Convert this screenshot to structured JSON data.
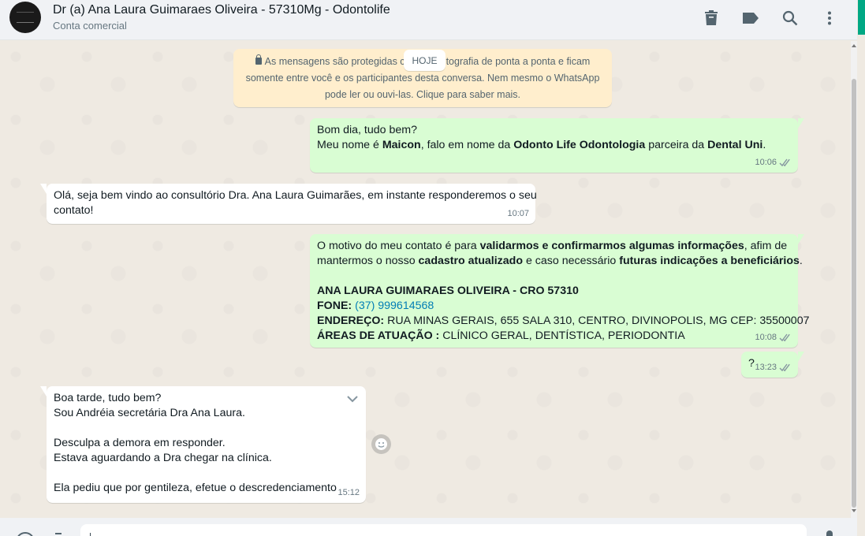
{
  "header": {
    "title": "Dr (a) Ana Laura Guimaraes Oliveira - 57310Mg - Odontolife",
    "subtitle": "Conta comercial",
    "icons": [
      "delete-icon",
      "label-icon",
      "search-icon",
      "more-vert-icon"
    ]
  },
  "chat": {
    "encryption_notice": {
      "line1_a": "As mensagens são protegidas c",
      "line1_b": "tografia de ponta a ponta e ficam",
      "line2": "somente entre você e os participantes desta conversa. Nem mesmo o WhatsApp",
      "line3": "pode ler ou ouvi-las. Clique para saber mais."
    },
    "date_label": "HOJE",
    "messages": [
      {
        "direction": "out",
        "line1": "Bom dia, tudo bem?",
        "line2_parts": [
          "Meu nome é ",
          "Maicon",
          ", falo em nome da ",
          "Odonto Life Odontologia",
          " parceira da ",
          "Dental Uni",
          "."
        ],
        "time": "10:06"
      },
      {
        "direction": "in",
        "line1": "Olá, seja bem vindo ao consultório Dra. Ana Laura Guimarães, em instante responderemos o seu",
        "line2": "contato!",
        "time": "10:07"
      },
      {
        "direction": "out",
        "p1_l1_parts": [
          "O motivo do meu contato é para ",
          "validarmos e confirmarmos algumas informações",
          ", afim de"
        ],
        "p1_l2_parts": [
          "mantermos o nosso ",
          "cadastro atualizado",
          " e caso necessário ",
          "futuras indicações a beneficiários",
          "."
        ],
        "name_line": "ANA LAURA GUIMARAES OLIVEIRA - CRO 57310",
        "phone_label": "FONE:",
        "phone_value": "(37) 999614568",
        "address_label": "ENDEREÇO:",
        "address_value": " RUA MINAS GERAIS, 655 SALA 310, CENTRO, DIVINOPOLIS, MG CEP: 35500007",
        "areas_label": "ÁREAS DE ATUAÇÃO :",
        "areas_value": " CLÍNICO GERAL, DENTÍSTICA, PERIODONTIA",
        "time": "10:08"
      },
      {
        "direction": "out",
        "text": "?",
        "time": "13:23"
      },
      {
        "direction": "in",
        "l1": "Boa tarde, tudo bem?",
        "l2": "Sou Andréia secretária Dra Ana Laura.",
        "l3": "Desculpa a demora em responder.",
        "l4": "Estava aguardando a Dra chegar na clínica.",
        "l5": "Ela pediu que por gentileza, efetue o descredenciamento",
        "time": "15:12"
      }
    ]
  },
  "colors": {
    "outgoing_bubble": "#d9fdd3",
    "incoming_bubble": "#ffffff",
    "notice_bg": "#ffeecd",
    "accent": "#00a884",
    "read_ticks": "#8696a0",
    "link": "#027eb5"
  }
}
